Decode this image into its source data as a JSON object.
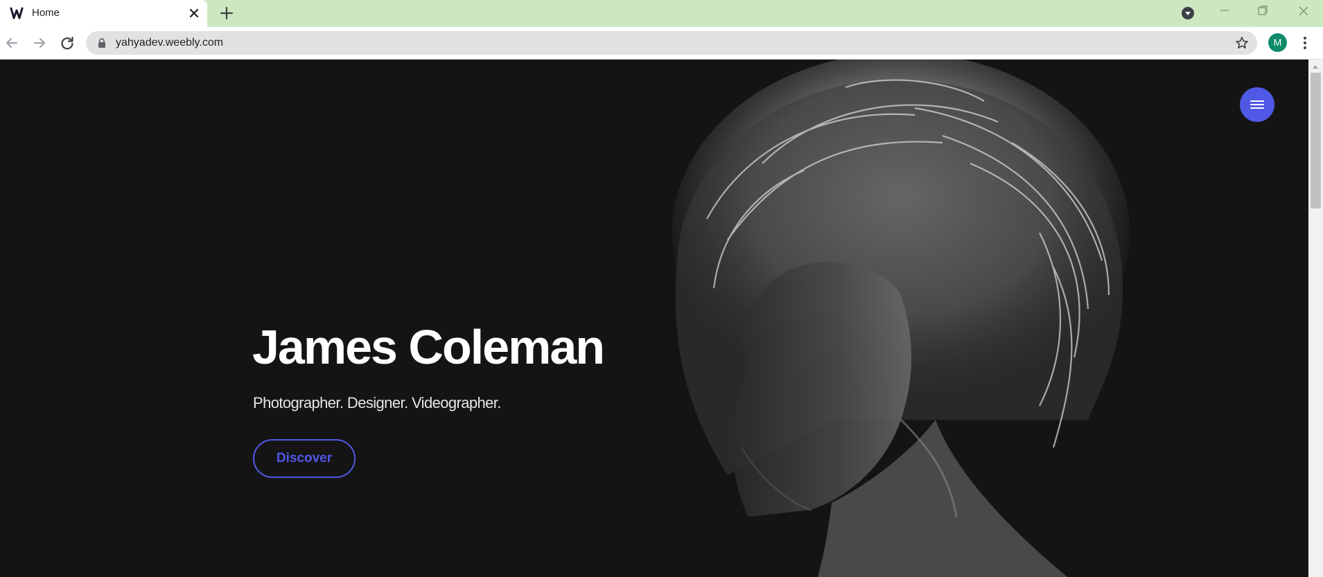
{
  "browser": {
    "tab": {
      "title": "Home",
      "favicon": "weebly-logo-icon"
    },
    "toolbar": {
      "url": "yahyadev.weebly.com",
      "profile_initial": "M"
    },
    "colors": {
      "tabstrip": "#cde8c1",
      "avatar": "#0f8a6a"
    }
  },
  "page": {
    "menu_button_icon": "hamburger-icon",
    "hero": {
      "name": "James Coleman",
      "tagline": "Photographer. Designer. Videographer.",
      "cta_label": "Discover"
    },
    "colors": {
      "background": "#151415",
      "accent": "#5058e6",
      "text": "#ffffff"
    }
  }
}
